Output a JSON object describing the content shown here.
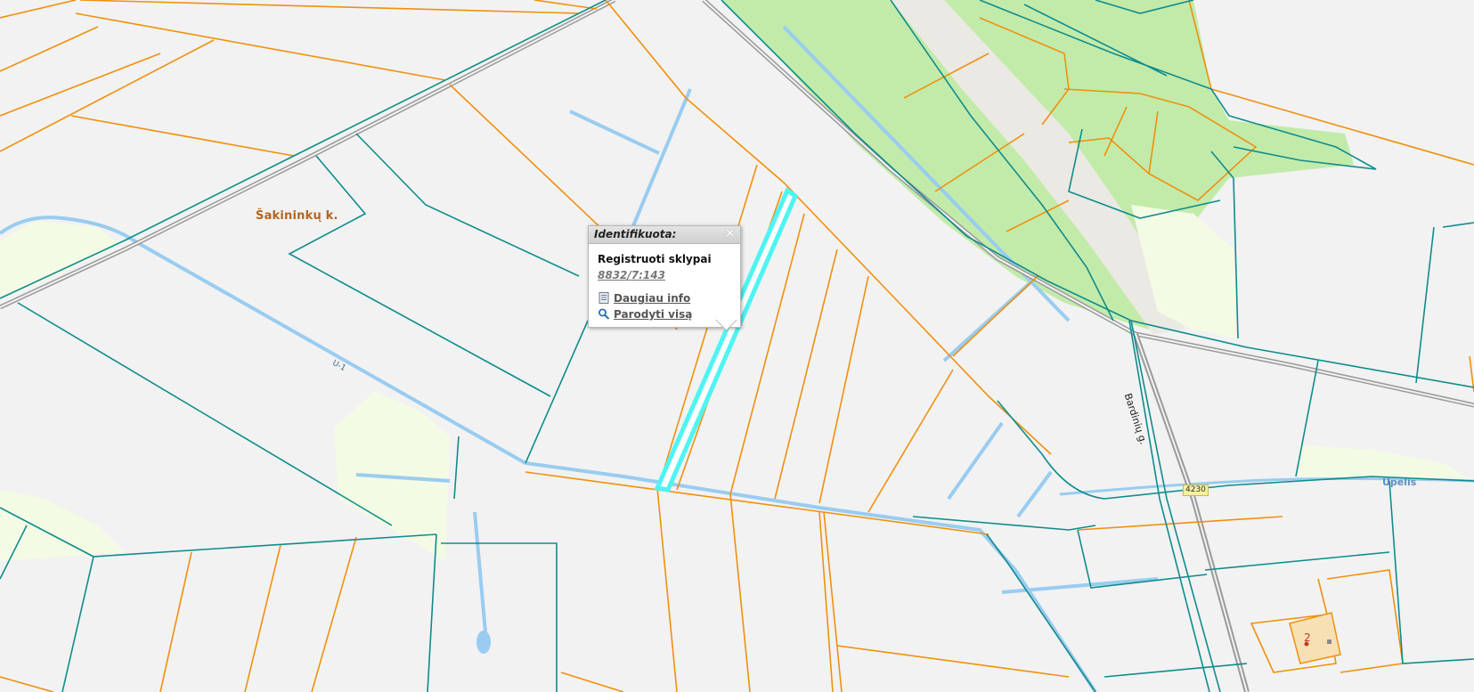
{
  "map": {
    "labels": {
      "village": "Šakininkų k.",
      "street": "Bardinių g.",
      "river": "Upelis",
      "ditch": "U-1",
      "road_number": "4230",
      "house_number": "2"
    },
    "colors": {
      "background": "#f2f2f2",
      "parcel_boundary": "#f0900e",
      "cadastral_boundary": "#0f8c8c",
      "water": "#99ccf0",
      "forest": "#c2ebaa",
      "meadow": "#f3fbe4",
      "selected_parcel": "#4ef4f2",
      "road": "#9a9a9a"
    }
  },
  "popup": {
    "title": "Identifikuota:",
    "close_symbol": "✕",
    "section": "Registruoti sklypai",
    "parcel_id": "8832/7:143",
    "more_info": "Daugiau info",
    "show_all": "Parodyti visą",
    "icons": {
      "more_info": "document-icon",
      "show_all": "magnifier-icon"
    }
  }
}
